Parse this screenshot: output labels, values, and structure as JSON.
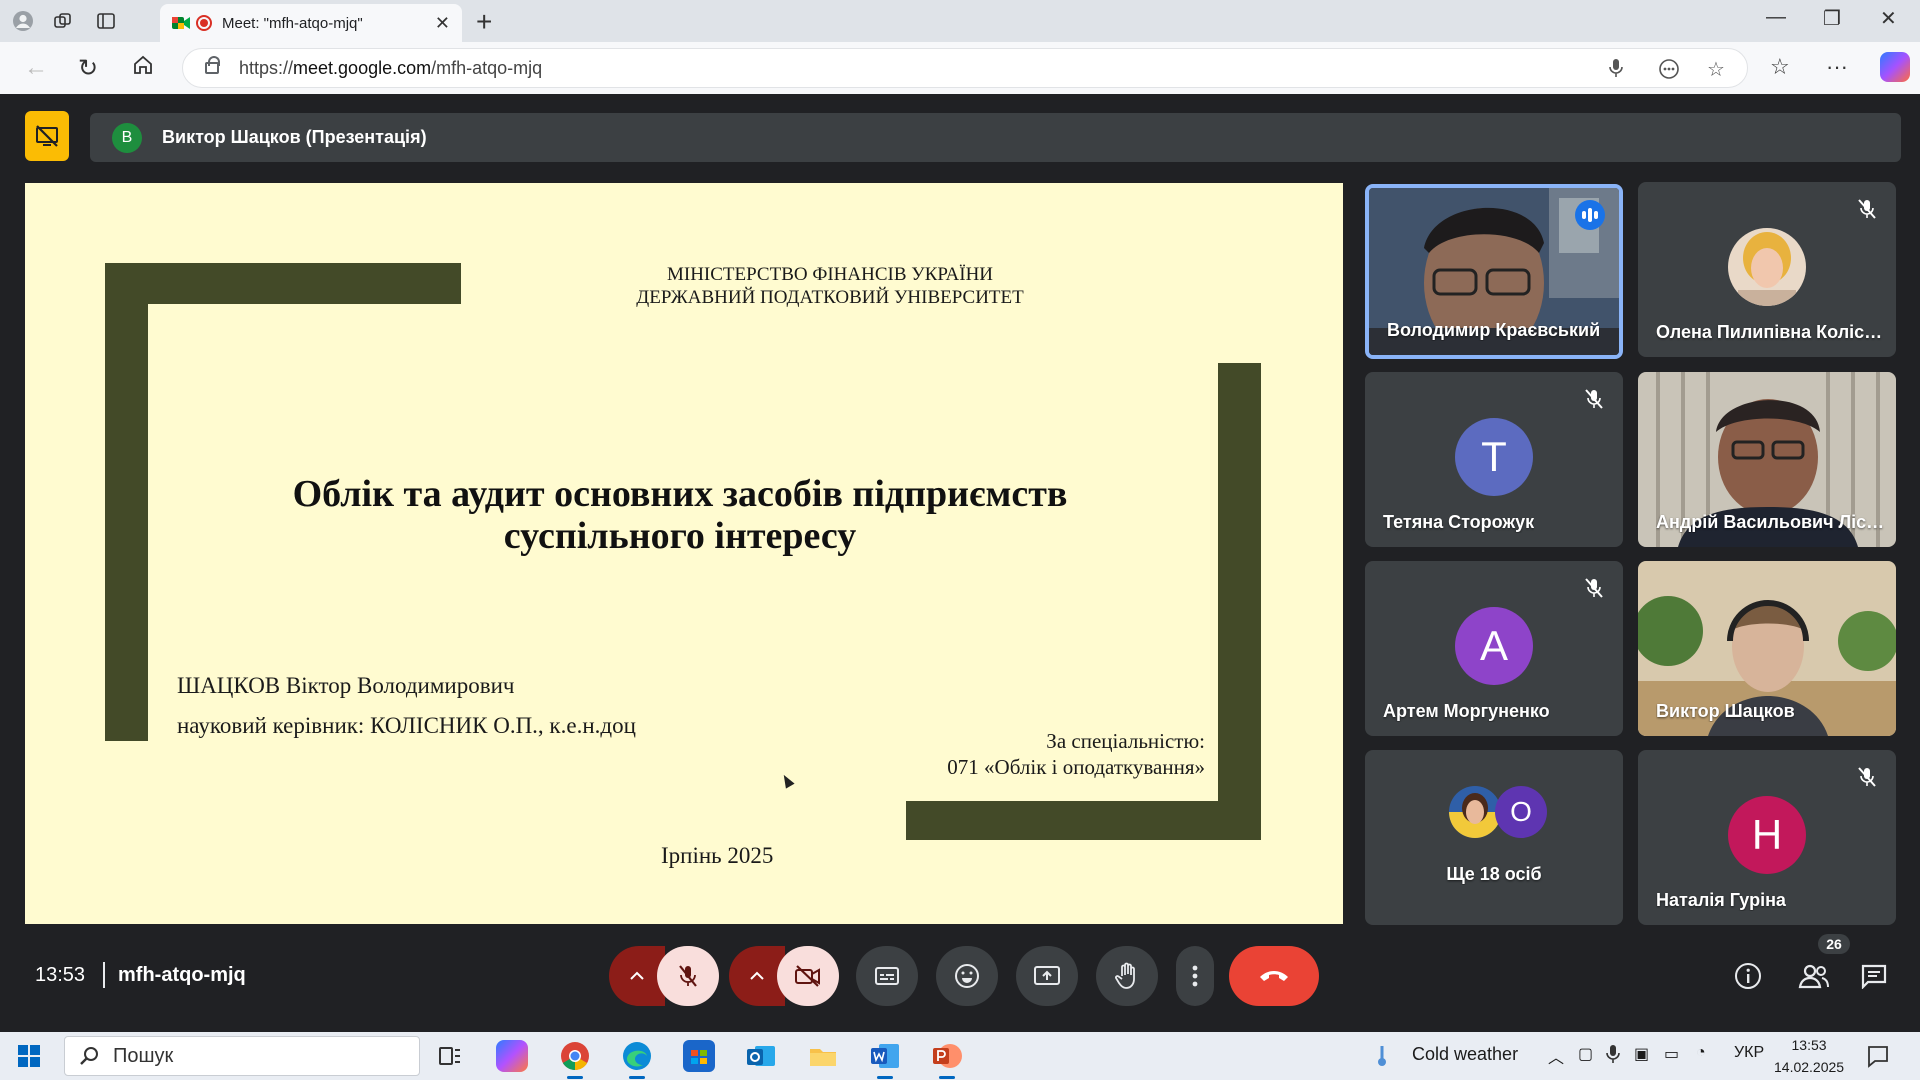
{
  "browser": {
    "tab_title": "Meet: \"mfh-atqo-mjq\"",
    "url_prefix": "https://",
    "url_host": "meet.google.com",
    "url_path": "/mfh-atqo-mjq"
  },
  "presentation_bar": {
    "avatar_letter": "В",
    "presenter_label": "Виктор Шацков (Презентація)"
  },
  "slide": {
    "ministry_line1": "МІНІСТЕРСТВО ФІНАНСІВ УКРАЇНИ",
    "ministry_line2": "ДЕРЖАВНИЙ ПОДАТКОВИЙ УНІВЕРСИТЕТ",
    "title_line1": "Облік та аудит основних засобів підприємств",
    "title_line2": "суспільного інтересу",
    "author": "ШАЦКОВ Віктор Володимирович",
    "supervisor": "науковий керівник: КОЛІСНИК О.П., к.е.н.доц",
    "specialty_line1": "За спеціальністю:",
    "specialty_line2": "071 «Облік і оподаткування»",
    "city_year": "Ірпінь 2025"
  },
  "participants": [
    {
      "name": "Володимир Краєвський",
      "kind": "video",
      "state": "speaking"
    },
    {
      "name": "Олена Пилипівна Колісник",
      "kind": "photo",
      "state": "muted"
    },
    {
      "name": "Тетяна Сторожук",
      "kind": "letter",
      "letter": "Т",
      "color": "#5c6bc0",
      "state": "muted"
    },
    {
      "name": "Андрій Васильович Лісовий",
      "kind": "video",
      "state": ""
    },
    {
      "name": "Артем Моргуненко",
      "kind": "letter",
      "letter": "А",
      "color": "#8e44c9",
      "state": "muted"
    },
    {
      "name": "Виктор Шацков",
      "kind": "video",
      "state": ""
    },
    {
      "name": "Ще 18 осіб",
      "kind": "group",
      "letter": "О",
      "color": "#5e35b1",
      "state": ""
    },
    {
      "name": "Наталія Гуріна",
      "kind": "letter",
      "letter": "Н",
      "color": "#c2185b",
      "state": "muted"
    }
  ],
  "controls": {
    "time": "13:53",
    "meeting_code": "mfh-atqo-mjq",
    "people_count": "26"
  },
  "taskbar": {
    "search_placeholder": "Пошук",
    "weather": "Cold weather",
    "language": "УКР",
    "time": "13:53",
    "date": "14.02.2025"
  },
  "colors": {
    "slide_bg": "#fffbd0",
    "slide_frame": "#434a28",
    "stop_share": "#fbbc04",
    "hangup": "#ea4335",
    "active_border": "#8ab4f8"
  }
}
